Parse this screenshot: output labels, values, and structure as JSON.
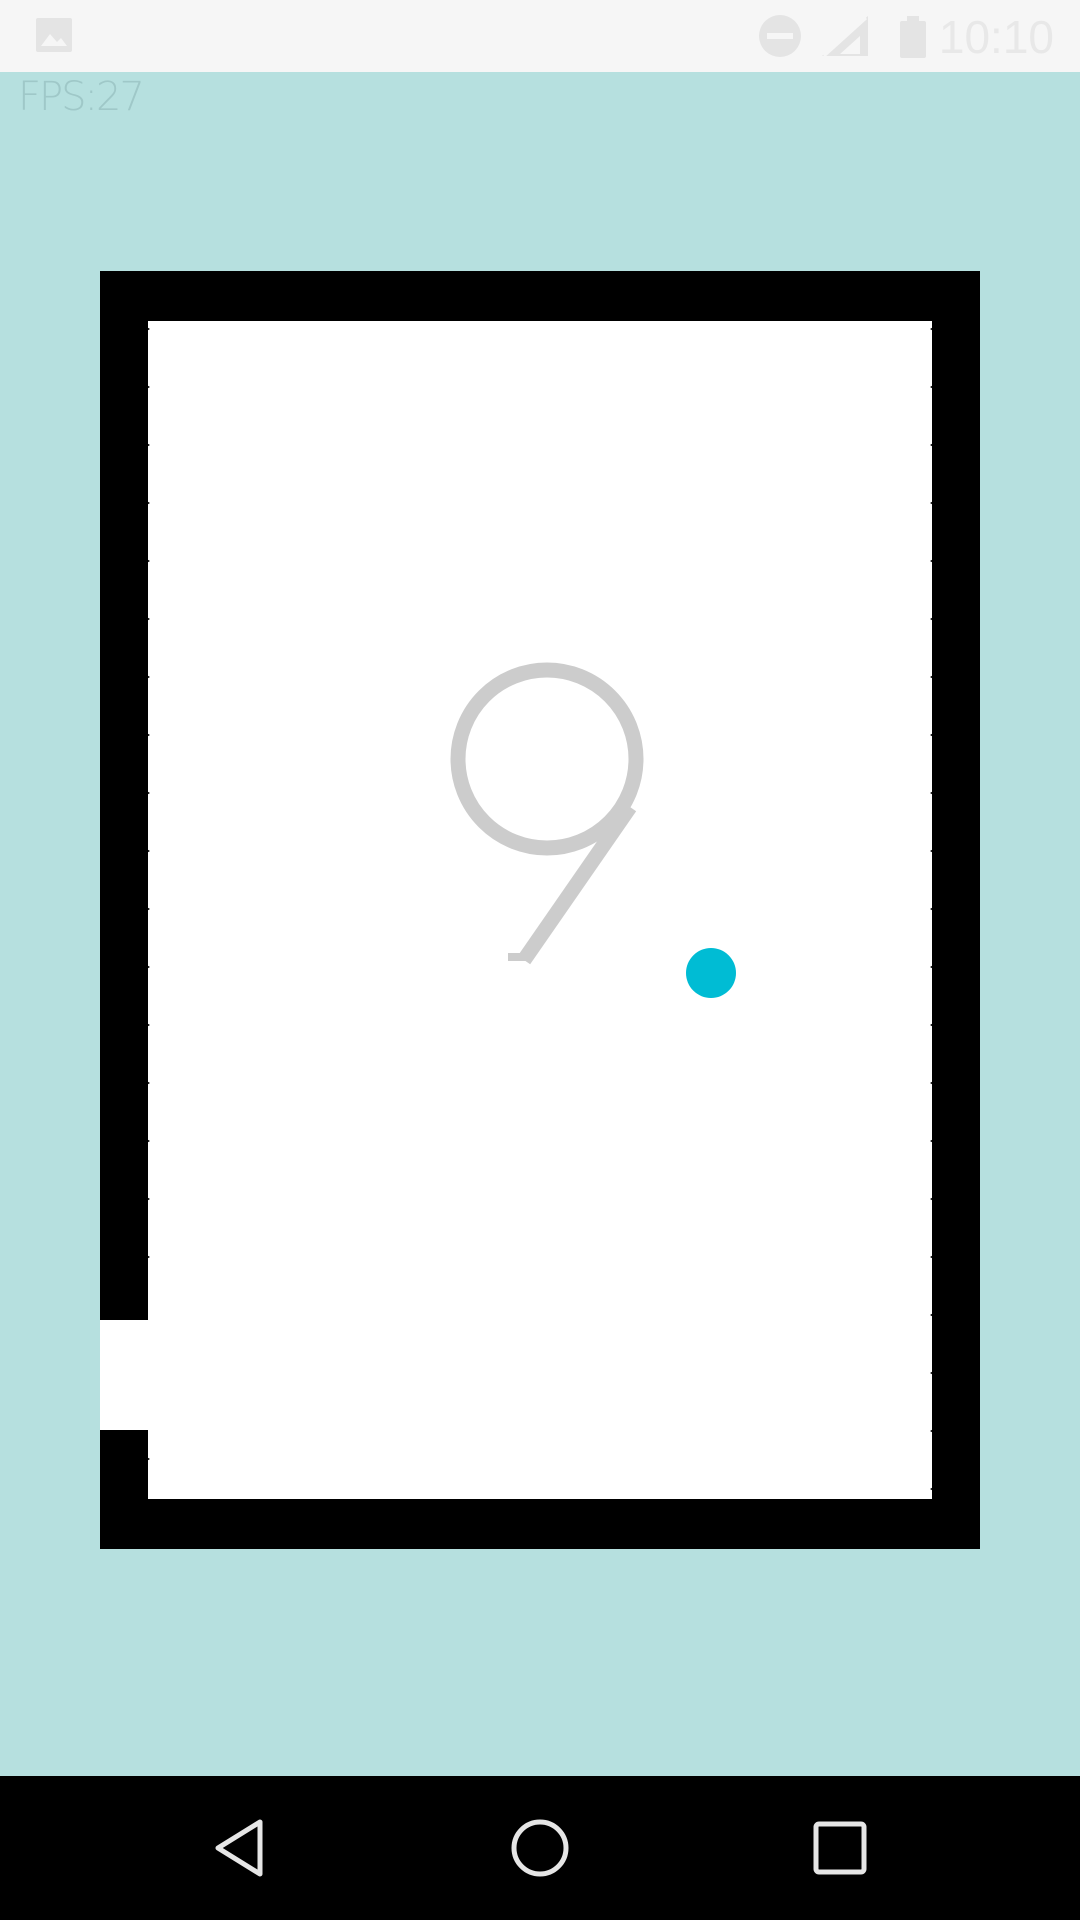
{
  "status_bar": {
    "time": "10:10",
    "icons": [
      "image-icon",
      "do-not-disturb-icon",
      "signal-icon",
      "battery-icon"
    ]
  },
  "hud": {
    "fps_label": "FPS:27"
  },
  "game": {
    "score": "9",
    "colors": {
      "background": "#b6e0df",
      "board": "#ffffff",
      "spikes": "#000000",
      "score": "#cccccc",
      "ball": "#00bcd4"
    }
  },
  "nav_bar": {
    "buttons": [
      "back-icon",
      "home-icon",
      "recents-icon"
    ]
  }
}
